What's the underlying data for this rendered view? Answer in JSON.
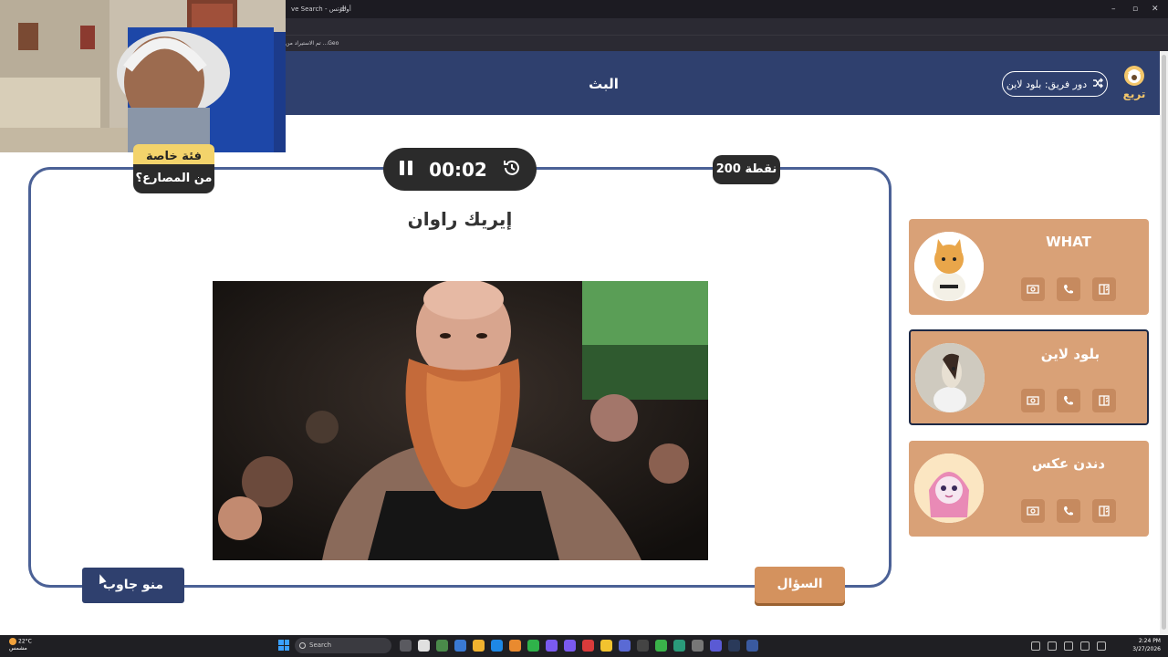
{
  "browser": {
    "tab_title": "ve Search - أولبوتس",
    "new_tab": "+",
    "bookmark": "تم الاستيراد من ...Geo",
    "window_controls": [
      "–",
      "▫",
      "✕"
    ]
  },
  "header": {
    "title": "البث",
    "logo_text": "تريع",
    "turn_button_label": "دور فريق: بلود لاين"
  },
  "game": {
    "points_label": "200 نقطة",
    "timer": "00:02",
    "category_top": "فئة خاصة",
    "category_question": "من المصارع؟",
    "answer_title": "إيريك راوان",
    "question_button": "السؤال",
    "who_answered_button": "منو جاوب"
  },
  "teams": [
    {
      "name": "WHAT",
      "active": false,
      "avatar_icon": "cat-avatar-icon"
    },
    {
      "name": "بلود لاين",
      "active": true,
      "avatar_icon": "horse-avatar-icon"
    },
    {
      "name": "دندن عكس",
      "active": false,
      "avatar_icon": "pink-cat-avatar-icon"
    }
  ],
  "taskbar": {
    "weather_temp": "22°C",
    "weather_desc": "مشمس",
    "search_label": "Search",
    "time": "2:24 PM",
    "date": "3/27/2026"
  },
  "colors": {
    "header_bg": "#2f406e",
    "board_border": "#4b6196",
    "team_card": "#d9a177",
    "accent_yellow": "#f3d36b",
    "dark_chip": "#2b2b2b"
  }
}
